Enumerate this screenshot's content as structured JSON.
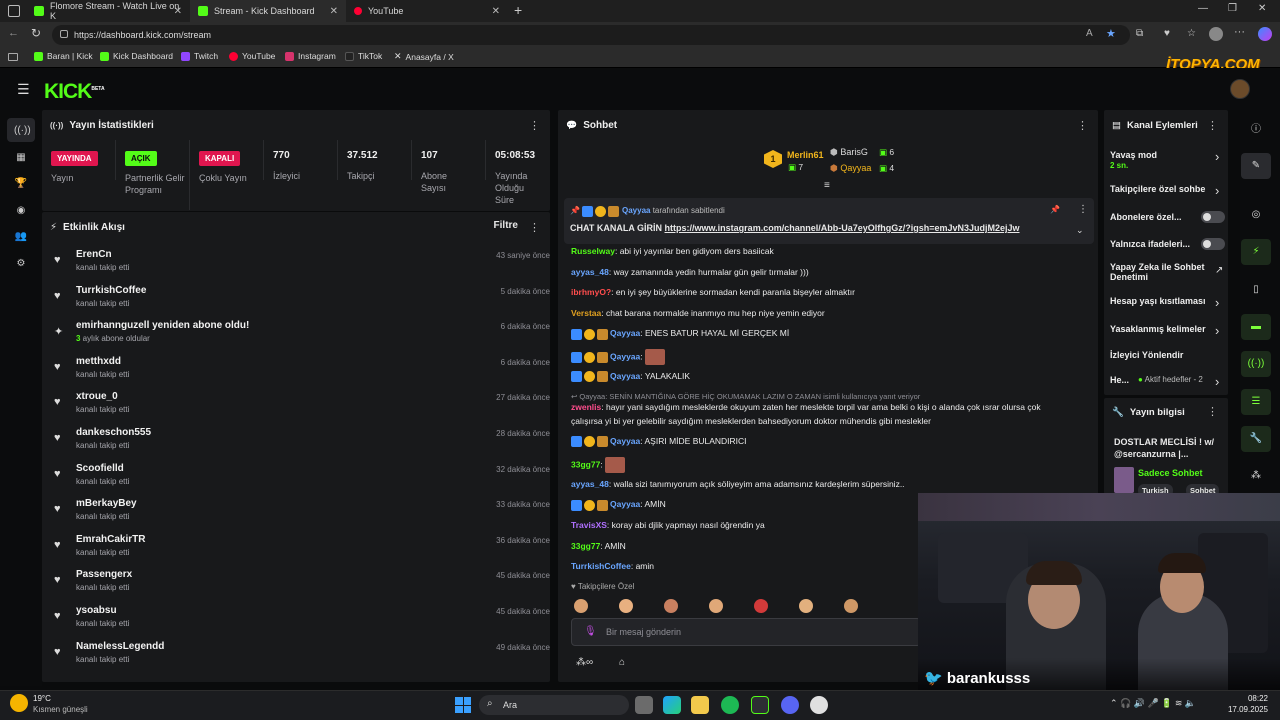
{
  "browser": {
    "tabs": [
      {
        "title": "Flomore Stream - Watch Live on K"
      },
      {
        "title": "Stream - Kick Dashboard"
      },
      {
        "title": "YouTube"
      }
    ],
    "url": "https://dashboard.kick.com/stream",
    "bookmarks": [
      "Baran | Kick",
      "Kick Dashboard",
      "Twitch",
      "YouTube",
      "Instagram",
      "TikTok",
      "Anasayfa / X"
    ]
  },
  "watermark": "İTOPYA.COM",
  "kick": {
    "logo": "KICK",
    "logo_badge": "BETA"
  },
  "stats": {
    "title": "Yayın İstatistikleri",
    "items": [
      {
        "pill": "YAYINDA",
        "label": "Yayın",
        "pill_color": "#e0164f"
      },
      {
        "pill": "AÇIK",
        "label": "Partnerlik Gelir Programı",
        "pill_color": "#53fc18"
      },
      {
        "pill": "KAPALI",
        "label": "Çoklu Yayın",
        "pill_color": "#e0164f"
      },
      {
        "value": "770",
        "label": "İzleyici"
      },
      {
        "value": "37.512",
        "label": "Takipçi"
      },
      {
        "value": "107",
        "label": "Abone Sayısı"
      },
      {
        "value": "05:08:53",
        "label": "Yayında Olduğu Süre"
      }
    ]
  },
  "activity": {
    "title": "Etkinlik Akışı",
    "filter": "Filtre",
    "items": [
      {
        "name": "ErenCn",
        "sub": "kanalı takip etti",
        "time": "43 saniye önce",
        "icon": "heart"
      },
      {
        "name": "TurrkishCoffee",
        "sub": "kanalı takip etti",
        "time": "5 dakika önce",
        "icon": "heart"
      },
      {
        "name": "emirhannguzell yeniden abone oldu!",
        "sub_count": "3",
        "sub": "aylık abone oldular",
        "time": "6 dakika önce",
        "icon": "sparkle"
      },
      {
        "name": "metthxdd",
        "sub": "kanalı takip etti",
        "time": "6 dakika önce",
        "icon": "heart"
      },
      {
        "name": "xtroue_0",
        "sub": "kanalı takip etti",
        "time": "27 dakika önce",
        "icon": "heart"
      },
      {
        "name": "dankeschon555",
        "sub": "kanalı takip etti",
        "time": "28 dakika önce",
        "icon": "heart"
      },
      {
        "name": "Scoofielld",
        "sub": "kanalı takip etti",
        "time": "32 dakika önce",
        "icon": "heart"
      },
      {
        "name": "mBerkayBey",
        "sub": "kanalı takip etti",
        "time": "33 dakika önce",
        "icon": "heart"
      },
      {
        "name": "EmrahCakirTR",
        "sub": "kanalı takip etti",
        "time": "36 dakika önce",
        "icon": "heart"
      },
      {
        "name": "Passengerx",
        "sub": "kanalı takip etti",
        "time": "45 dakika önce",
        "icon": "heart"
      },
      {
        "name": "ysoabsu",
        "sub": "kanalı takip etti",
        "time": "45 dakika önce",
        "icon": "heart"
      },
      {
        "name": "NamelessLegendd",
        "sub": "kanalı takip etti",
        "time": "49 dakika önce",
        "icon": "heart"
      }
    ]
  },
  "chat": {
    "title": "Sohbet",
    "top_gifters": [
      {
        "rank": "1",
        "name": "Merlin61",
        "count": "7"
      },
      {
        "name": "BarisG",
        "count": "6"
      },
      {
        "name": "Qayyaa",
        "count": "4"
      }
    ],
    "pinned": {
      "by_name": "Qayyaa",
      "by_suffix": "tarafından sabitlendi",
      "text": "CHAT KANALA GİRİN",
      "link": "https://www.instagram.com/channel/Abb-Ua7eyOlfhgGz/?igsh=emJvN3JudjM2ejJw"
    },
    "messages": [
      {
        "user": "Russelway",
        "color": "#53fc18",
        "text": "abi iyi yayınlar ben gidiyom ders basiicak",
        "badges": false
      },
      {
        "user": "ayyas_48",
        "color": "#6aa6ff",
        "text": "way zamanında yedin hurmalar gün gelir tırmalar )))",
        "badges": false
      },
      {
        "user": "ibrhmyO?",
        "color": "#ff4d4d",
        "text": "en iyi şey büyüklerine sormadan kendi paranla bişeyler almaktır",
        "badges": false
      },
      {
        "user": "Verstaa",
        "color": "#e0a020",
        "text": "chat barana normalde inanmıyo mu hep niye yemin ediyor",
        "badges": false
      },
      {
        "user": "Qayyaa",
        "color": "#6aa6ff",
        "text": "ENES BATUR HAYAL Mİ GERÇEK Mİ",
        "badges": true
      },
      {
        "user": "Qayyaa",
        "color": "#6aa6ff",
        "text": "",
        "emote": true,
        "badges": true
      },
      {
        "user": "Qayyaa",
        "color": "#6aa6ff",
        "text": "YALAKALIK",
        "badges": true
      },
      {
        "reply_to": "Qayyaa: SENİN MANTIĞINA GÖRE HİÇ OKUMAMAK LAZIM O ZAMAN isimli kullanıcıya yanıt veriyor",
        "user": "zwenlis",
        "color": "#ff4d8d",
        "text": "hayır yani saydığım mesleklerde okuyum zaten her meslekte torpil var ama belki o kişi o alanda çok ısrar olursa çok",
        "text2": "çalışırsa yi bi yer gelebilir saydığım mesleklerden bahsediyorum doktor mühendis gibi meslekler"
      },
      {
        "user": "Qayyaa",
        "color": "#6aa6ff",
        "text": "AŞIRI MİDE BULANDIRICI",
        "badges": true
      },
      {
        "user": "33gg77",
        "color": "#53fc18",
        "text": "",
        "emote": true,
        "badges": false
      },
      {
        "user": "ayyas_48",
        "color": "#6aa6ff",
        "text": "walla sizi tanımıyorum açık söliyeyim ama adamsınız kardeşlerim süpersiniz..",
        "badges": false
      },
      {
        "user": "Qayyaa",
        "color": "#6aa6ff",
        "text": "AMİN",
        "badges": true
      },
      {
        "user": "TravisXS",
        "color": "#b070ff",
        "text": "koray abi djlik yapmayı nasıl öğrendin ya",
        "badges": false
      },
      {
        "user": "33gg77",
        "color": "#53fc18",
        "text": "AMİN",
        "badges": false
      },
      {
        "user": "TurrkishCoffee",
        "color": "#6aa6ff",
        "text": "amin",
        "badges": false
      }
    ],
    "followers_only_label": "Takipçilere Özel",
    "input_placeholder": "Bir mesaj gönderin"
  },
  "channel_actions": {
    "title": "Kanal Eylemleri",
    "items": [
      {
        "label": "Yavaş mod",
        "sub": "2 sn.",
        "kind": "chevron"
      },
      {
        "label": "Takipçilere özel sohbe",
        "kind": "chevron"
      },
      {
        "label": "Abonelere özel...",
        "kind": "toggle"
      },
      {
        "label": "Yalnızca ifadeleri...",
        "kind": "toggle"
      },
      {
        "label": "Yapay Zeka ile Sohbet Denetimi",
        "kind": "external"
      },
      {
        "label": "Hesap yaşı kısıtlaması",
        "kind": "chevron"
      },
      {
        "label": "Yasaklanmış kelimeler",
        "kind": "chevron"
      },
      {
        "label": "İzleyici Yönlendir",
        "kind": "none"
      },
      {
        "label": "He...",
        "sub": "Aktif hedefler - 2",
        "kind": "chevron"
      }
    ]
  },
  "stream_info": {
    "title": "Yayın bilgisi",
    "stream_title": "DOSTLAR MECLİSİ ! w/ @sercanzurna |...",
    "category": "Sadece Sohbet",
    "tags": [
      "Turkish",
      "Sohbet"
    ]
  },
  "overlay": {
    "twitter_handle": "barankusss"
  },
  "taskbar": {
    "weather_temp": "19°C",
    "weather_desc": "Kısmen güneşli",
    "search": "Ara",
    "time": "08:22",
    "date": "17.09.2025"
  }
}
